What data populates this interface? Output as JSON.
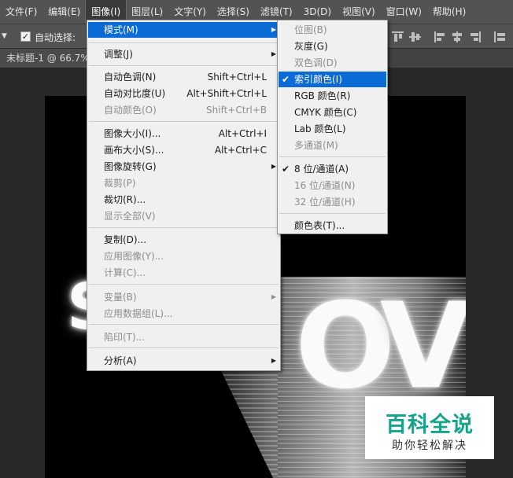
{
  "menubar": {
    "items": [
      {
        "label": "文件(F)"
      },
      {
        "label": "编辑(E)"
      },
      {
        "label": "图像(I)",
        "active": true
      },
      {
        "label": "图层(L)"
      },
      {
        "label": "文字(Y)"
      },
      {
        "label": "选择(S)"
      },
      {
        "label": "滤镜(T)"
      },
      {
        "label": "3D(D)"
      },
      {
        "label": "视图(V)"
      },
      {
        "label": "窗口(W)"
      },
      {
        "label": "帮助(H)"
      }
    ]
  },
  "options": {
    "auto_select_checked": true,
    "auto_select_label": "自动选择:"
  },
  "tab": {
    "title": "未标题-1 @ 66.7%"
  },
  "image_menu": {
    "items": [
      {
        "label": "模式(M)",
        "submenu": true,
        "highlight": true
      },
      {
        "label": "调整(J)",
        "submenu": true
      },
      {
        "label": "自动色调(N)",
        "shortcut": "Shift+Ctrl+L"
      },
      {
        "label": "自动对比度(U)",
        "shortcut": "Alt+Shift+Ctrl+L"
      },
      {
        "label": "自动颜色(O)",
        "shortcut": "Shift+Ctrl+B",
        "disabled": true
      },
      {
        "label": "图像大小(I)...",
        "shortcut": "Alt+Ctrl+I"
      },
      {
        "label": "画布大小(S)...",
        "shortcut": "Alt+Ctrl+C"
      },
      {
        "label": "图像旋转(G)",
        "submenu": true
      },
      {
        "label": "裁剪(P)",
        "disabled": true
      },
      {
        "label": "裁切(R)..."
      },
      {
        "label": "显示全部(V)",
        "disabled": true
      },
      {
        "label": "复制(D)..."
      },
      {
        "label": "应用图像(Y)...",
        "disabled": true
      },
      {
        "label": "计算(C)...",
        "disabled": true
      },
      {
        "label": "变量(B)",
        "submenu": true,
        "disabled": true
      },
      {
        "label": "应用数据组(L)...",
        "disabled": true
      },
      {
        "label": "陷印(T)...",
        "disabled": true
      },
      {
        "label": "分析(A)",
        "submenu": true
      }
    ]
  },
  "mode_submenu": {
    "items": [
      {
        "label": "位图(B)",
        "disabled": true
      },
      {
        "label": "灰度(G)"
      },
      {
        "label": "双色调(D)",
        "disabled": true
      },
      {
        "label": "索引颜色(I)",
        "checked": true,
        "highlight": true
      },
      {
        "label": "RGB 颜色(R)"
      },
      {
        "label": "CMYK 颜色(C)"
      },
      {
        "label": "Lab 颜色(L)"
      },
      {
        "label": "多通道(M)",
        "disabled": true
      },
      {
        "label": "8 位/通道(A)",
        "checked": true
      },
      {
        "label": "16 位/通道(N)",
        "disabled": true
      },
      {
        "label": "32 位/通道(H)",
        "disabled": true
      },
      {
        "label": "颜色表(T)..."
      }
    ]
  },
  "artwork": {
    "letters": [
      "S",
      "O",
      "V"
    ]
  },
  "watermark": {
    "title": "百科全说",
    "subtitle": "助你轻松解决"
  },
  "colors": {
    "highlight": "#0a6ad6",
    "menu_bg": "#f0f0f0",
    "chrome": "#535353",
    "watermark_green": "#14a38b"
  }
}
